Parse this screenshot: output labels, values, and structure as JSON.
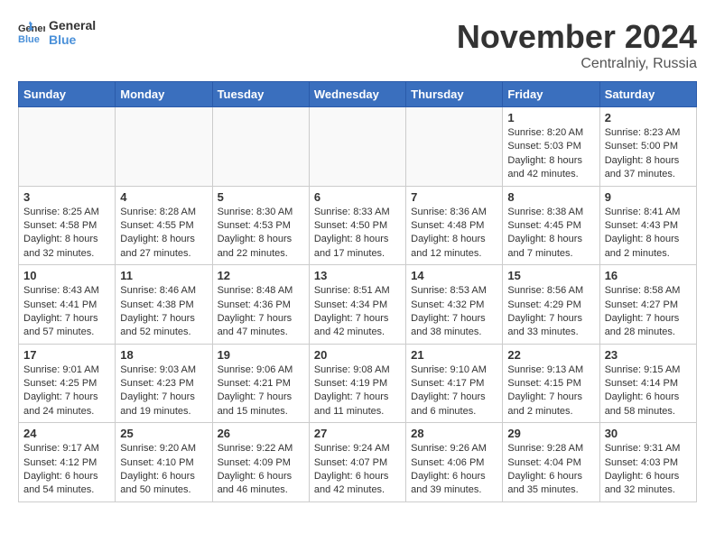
{
  "header": {
    "logo_line1": "General",
    "logo_line2": "Blue",
    "month_title": "November 2024",
    "location": "Centralniy, Russia"
  },
  "weekdays": [
    "Sunday",
    "Monday",
    "Tuesday",
    "Wednesday",
    "Thursday",
    "Friday",
    "Saturday"
  ],
  "weeks": [
    [
      {
        "day": "",
        "info": ""
      },
      {
        "day": "",
        "info": ""
      },
      {
        "day": "",
        "info": ""
      },
      {
        "day": "",
        "info": ""
      },
      {
        "day": "",
        "info": ""
      },
      {
        "day": "1",
        "info": "Sunrise: 8:20 AM\nSunset: 5:03 PM\nDaylight: 8 hours\nand 42 minutes."
      },
      {
        "day": "2",
        "info": "Sunrise: 8:23 AM\nSunset: 5:00 PM\nDaylight: 8 hours\nand 37 minutes."
      }
    ],
    [
      {
        "day": "3",
        "info": "Sunrise: 8:25 AM\nSunset: 4:58 PM\nDaylight: 8 hours\nand 32 minutes."
      },
      {
        "day": "4",
        "info": "Sunrise: 8:28 AM\nSunset: 4:55 PM\nDaylight: 8 hours\nand 27 minutes."
      },
      {
        "day": "5",
        "info": "Sunrise: 8:30 AM\nSunset: 4:53 PM\nDaylight: 8 hours\nand 22 minutes."
      },
      {
        "day": "6",
        "info": "Sunrise: 8:33 AM\nSunset: 4:50 PM\nDaylight: 8 hours\nand 17 minutes."
      },
      {
        "day": "7",
        "info": "Sunrise: 8:36 AM\nSunset: 4:48 PM\nDaylight: 8 hours\nand 12 minutes."
      },
      {
        "day": "8",
        "info": "Sunrise: 8:38 AM\nSunset: 4:45 PM\nDaylight: 8 hours\nand 7 minutes."
      },
      {
        "day": "9",
        "info": "Sunrise: 8:41 AM\nSunset: 4:43 PM\nDaylight: 8 hours\nand 2 minutes."
      }
    ],
    [
      {
        "day": "10",
        "info": "Sunrise: 8:43 AM\nSunset: 4:41 PM\nDaylight: 7 hours\nand 57 minutes."
      },
      {
        "day": "11",
        "info": "Sunrise: 8:46 AM\nSunset: 4:38 PM\nDaylight: 7 hours\nand 52 minutes."
      },
      {
        "day": "12",
        "info": "Sunrise: 8:48 AM\nSunset: 4:36 PM\nDaylight: 7 hours\nand 47 minutes."
      },
      {
        "day": "13",
        "info": "Sunrise: 8:51 AM\nSunset: 4:34 PM\nDaylight: 7 hours\nand 42 minutes."
      },
      {
        "day": "14",
        "info": "Sunrise: 8:53 AM\nSunset: 4:32 PM\nDaylight: 7 hours\nand 38 minutes."
      },
      {
        "day": "15",
        "info": "Sunrise: 8:56 AM\nSunset: 4:29 PM\nDaylight: 7 hours\nand 33 minutes."
      },
      {
        "day": "16",
        "info": "Sunrise: 8:58 AM\nSunset: 4:27 PM\nDaylight: 7 hours\nand 28 minutes."
      }
    ],
    [
      {
        "day": "17",
        "info": "Sunrise: 9:01 AM\nSunset: 4:25 PM\nDaylight: 7 hours\nand 24 minutes."
      },
      {
        "day": "18",
        "info": "Sunrise: 9:03 AM\nSunset: 4:23 PM\nDaylight: 7 hours\nand 19 minutes."
      },
      {
        "day": "19",
        "info": "Sunrise: 9:06 AM\nSunset: 4:21 PM\nDaylight: 7 hours\nand 15 minutes."
      },
      {
        "day": "20",
        "info": "Sunrise: 9:08 AM\nSunset: 4:19 PM\nDaylight: 7 hours\nand 11 minutes."
      },
      {
        "day": "21",
        "info": "Sunrise: 9:10 AM\nSunset: 4:17 PM\nDaylight: 7 hours\nand 6 minutes."
      },
      {
        "day": "22",
        "info": "Sunrise: 9:13 AM\nSunset: 4:15 PM\nDaylight: 7 hours\nand 2 minutes."
      },
      {
        "day": "23",
        "info": "Sunrise: 9:15 AM\nSunset: 4:14 PM\nDaylight: 6 hours\nand 58 minutes."
      }
    ],
    [
      {
        "day": "24",
        "info": "Sunrise: 9:17 AM\nSunset: 4:12 PM\nDaylight: 6 hours\nand 54 minutes."
      },
      {
        "day": "25",
        "info": "Sunrise: 9:20 AM\nSunset: 4:10 PM\nDaylight: 6 hours\nand 50 minutes."
      },
      {
        "day": "26",
        "info": "Sunrise: 9:22 AM\nSunset: 4:09 PM\nDaylight: 6 hours\nand 46 minutes."
      },
      {
        "day": "27",
        "info": "Sunrise: 9:24 AM\nSunset: 4:07 PM\nDaylight: 6 hours\nand 42 minutes."
      },
      {
        "day": "28",
        "info": "Sunrise: 9:26 AM\nSunset: 4:06 PM\nDaylight: 6 hours\nand 39 minutes."
      },
      {
        "day": "29",
        "info": "Sunrise: 9:28 AM\nSunset: 4:04 PM\nDaylight: 6 hours\nand 35 minutes."
      },
      {
        "day": "30",
        "info": "Sunrise: 9:31 AM\nSunset: 4:03 PM\nDaylight: 6 hours\nand 32 minutes."
      }
    ]
  ]
}
